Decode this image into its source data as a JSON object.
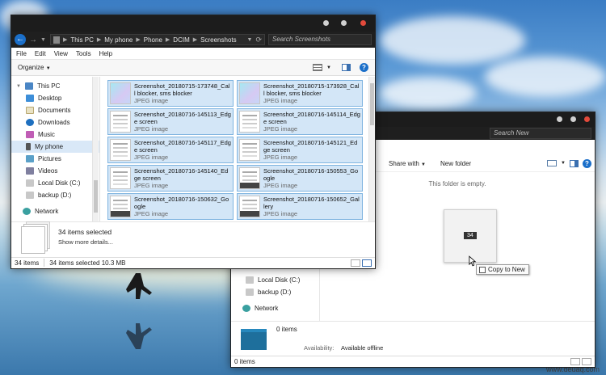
{
  "desktop": {
    "watermark": "www.deuaq.com"
  },
  "front": {
    "address": {
      "crumbs": [
        "This PC",
        "My phone",
        "Phone",
        "DCIM",
        "Screenshots"
      ],
      "search_placeholder": "Search Screenshots"
    },
    "menu": [
      "File",
      "Edit",
      "View",
      "Tools",
      "Help"
    ],
    "organize_label": "Organize",
    "nav": [
      {
        "label": "This PC",
        "icon": "computer-icon"
      },
      {
        "label": "Desktop",
        "icon": "desktop-icon"
      },
      {
        "label": "Documents",
        "icon": "documents-icon"
      },
      {
        "label": "Downloads",
        "icon": "downloads-icon"
      },
      {
        "label": "Music",
        "icon": "music-icon"
      },
      {
        "label": "My phone",
        "icon": "phone-icon",
        "selected": true
      },
      {
        "label": "Pictures",
        "icon": "pictures-icon"
      },
      {
        "label": "Videos",
        "icon": "videos-icon"
      },
      {
        "label": "Local Disk (C:)",
        "icon": "drive-icon"
      },
      {
        "label": "backup (D:)",
        "icon": "drive-icon"
      },
      {
        "label": "Network",
        "icon": "network-icon"
      }
    ],
    "files": [
      {
        "name": "Screenshot_20180715-173748_Call blocker, sms blocker",
        "type": "JPEG image",
        "thumb": "grad"
      },
      {
        "name": "Screenshot_20180715-173928_Call blocker, sms blocker",
        "type": "JPEG image",
        "thumb": "grad"
      },
      {
        "name": "Screenshot_20180716-145113_Edge screen",
        "type": "JPEG image",
        "thumb": "line"
      },
      {
        "name": "Screenshot_20180716-145114_Edge screen",
        "type": "JPEG image",
        "thumb": "line"
      },
      {
        "name": "Screenshot_20180716-145117_Edge screen",
        "type": "JPEG image",
        "thumb": "line"
      },
      {
        "name": "Screenshot_20180716-145121_Edge screen",
        "type": "JPEG image",
        "thumb": "line"
      },
      {
        "name": "Screenshot_20180716-145140_Edge screen",
        "type": "JPEG image",
        "thumb": "line"
      },
      {
        "name": "Screenshot_20180716-150553_Google",
        "type": "JPEG image",
        "thumb": "dark"
      },
      {
        "name": "Screenshot_20180716-150632_Google",
        "type": "JPEG image",
        "thumb": "dark"
      },
      {
        "name": "Screenshot_20180716-150652_Gallery",
        "type": "JPEG image",
        "thumb": "dark"
      }
    ],
    "details": {
      "selected": "34 items selected",
      "more": "Show more details..."
    },
    "status": {
      "count": "34 items",
      "selected": "34 items selected  10.3 MB"
    }
  },
  "back": {
    "search_placeholder": "Search New",
    "share_label": "Share with",
    "newfolder_label": "New folder",
    "empty_text": "This folder is empty.",
    "drag_count": "34",
    "tooltip": "Copy to New",
    "nav": [
      {
        "label": "Local Disk (C:)",
        "icon": "drive-icon"
      },
      {
        "label": "backup (D:)",
        "icon": "drive-icon"
      },
      {
        "label": "Network",
        "icon": "network-icon"
      }
    ],
    "details": {
      "count": "0 items",
      "availability_label": "Availability:",
      "availability_value": "Available offline"
    },
    "status": {
      "count": "0 items"
    }
  },
  "colors": {
    "accent": "#1b6fc9",
    "selection": "#d3e6f7",
    "folder": "#1e6f9c"
  }
}
